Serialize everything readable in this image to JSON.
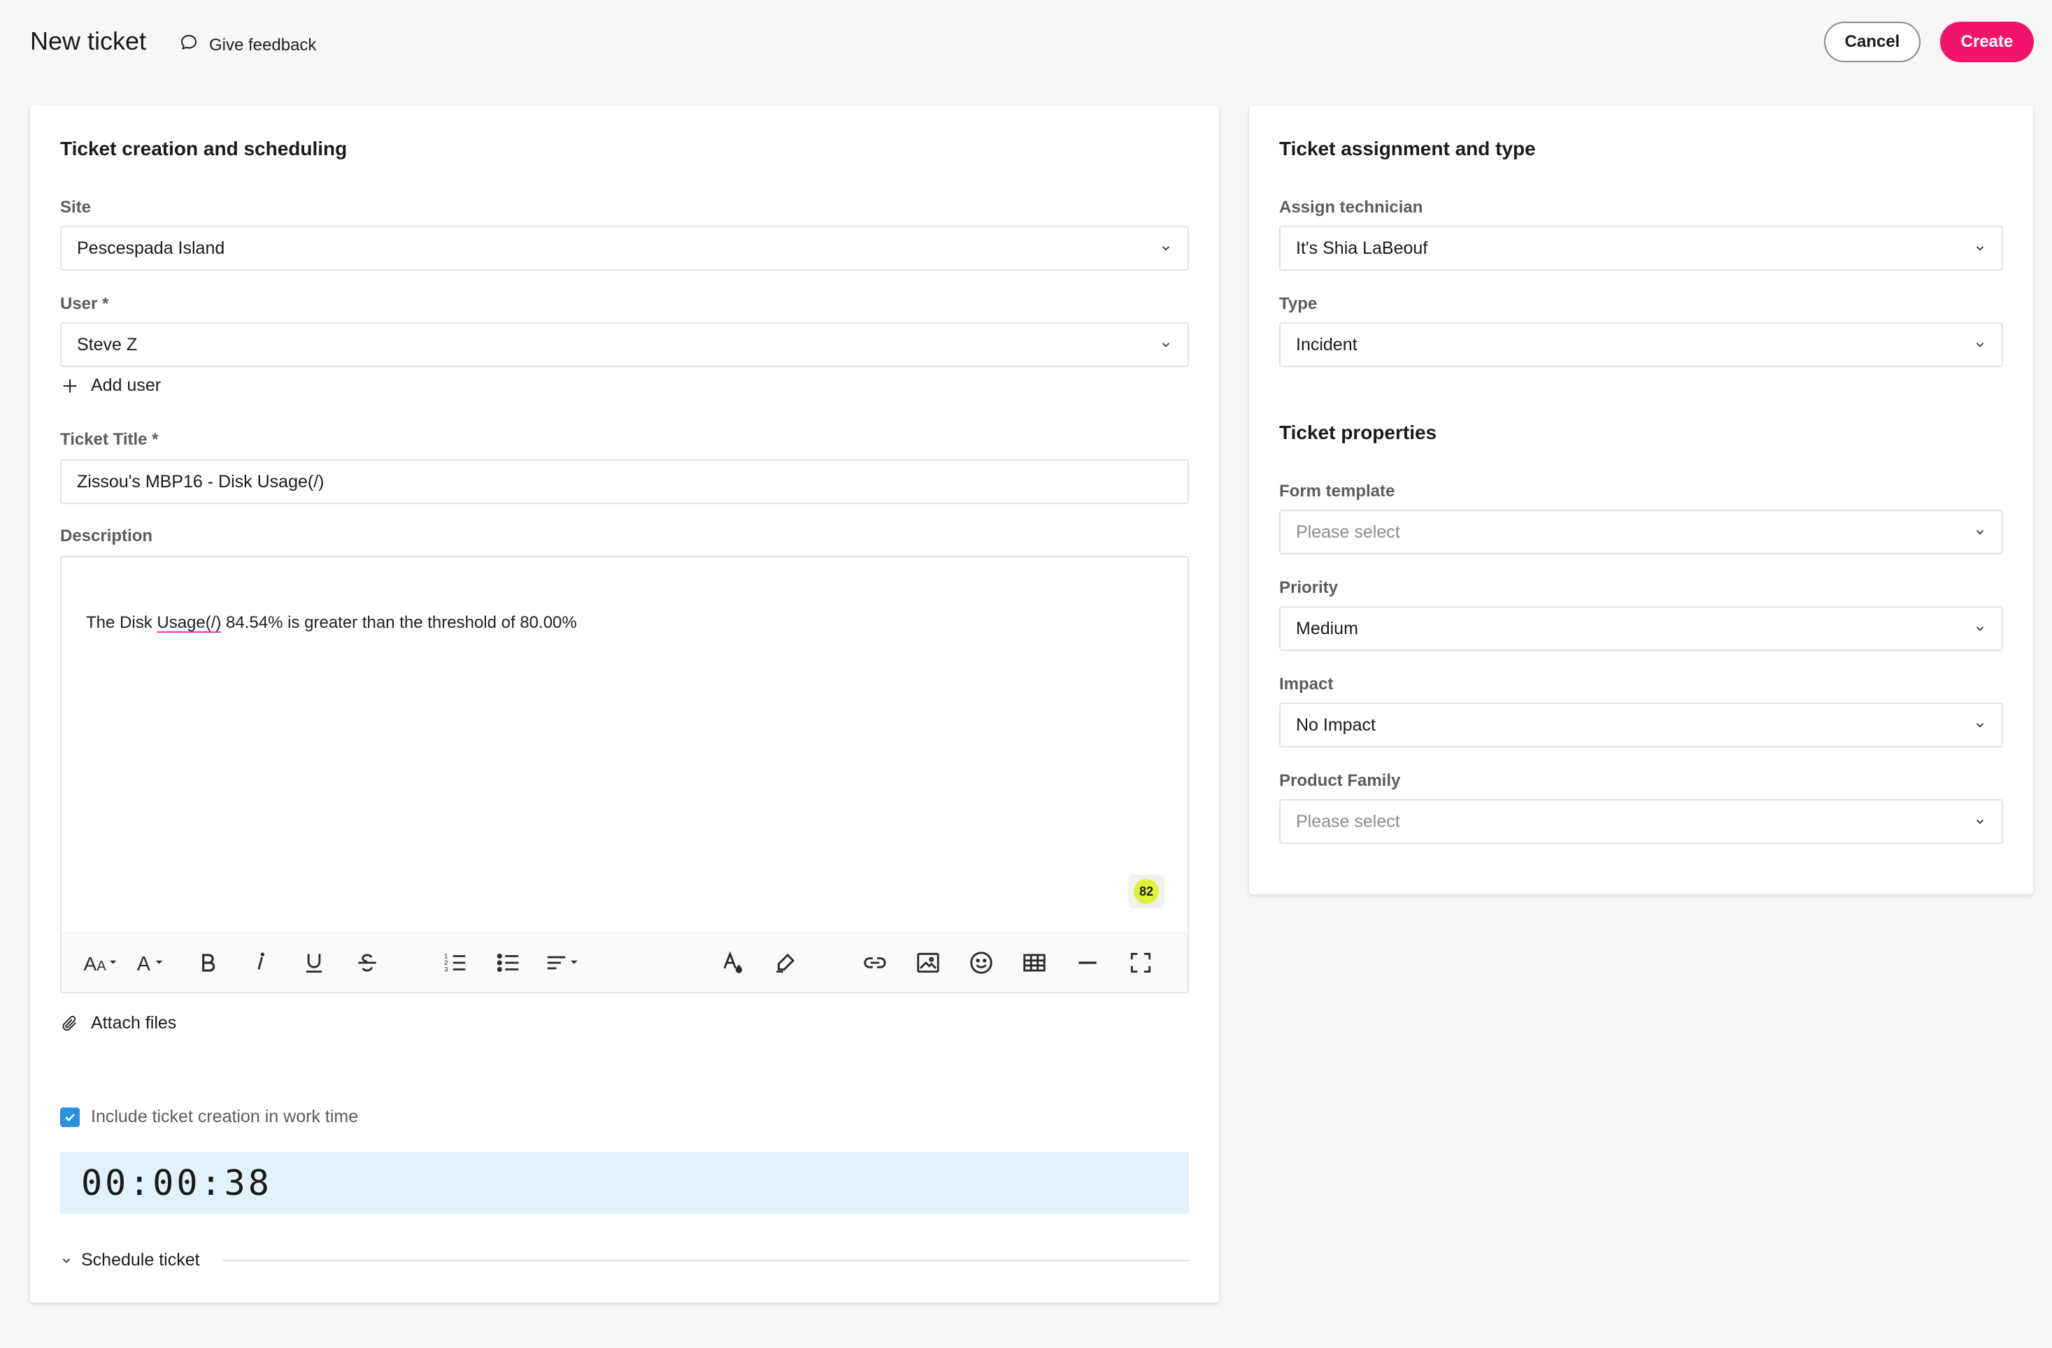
{
  "header": {
    "title": "New ticket",
    "feedback_label": "Give feedback",
    "cancel_label": "Cancel",
    "create_label": "Create"
  },
  "colors": {
    "accent": "#f2146b",
    "checkbox": "#2d8fe0",
    "timer_bg": "#e2f1fb",
    "badge": "#dff23a"
  },
  "left": {
    "section_title": "Ticket creation and scheduling",
    "site": {
      "label": "Site",
      "value": "Pescespada Island"
    },
    "user": {
      "label": "User *",
      "value": "Steve Z"
    },
    "add_user_label": "Add user",
    "ticket_title": {
      "label": "Ticket Title *",
      "value": "Zissou's MBP16 - Disk Usage(/)"
    },
    "description": {
      "label": "Description",
      "text_before": "The Disk ",
      "text_underlined": "Usage(/)",
      "text_after": " 84.54% is greater than the threshold of 80.00%",
      "count": "82"
    },
    "toolbar": [
      "font-size-icon",
      "font-family-icon",
      "bold-icon",
      "italic-icon",
      "underline-icon",
      "strikethrough-icon",
      "ordered-list-icon",
      "unordered-list-icon",
      "align-icon",
      "text-color-icon",
      "highlight-icon",
      "link-icon",
      "image-icon",
      "emoji-icon",
      "table-icon",
      "horizontal-rule-icon",
      "fullscreen-icon"
    ],
    "attach_label": "Attach files",
    "include_worktime_label": "Include ticket creation in work time",
    "include_worktime_checked": true,
    "timer": "00:00:38",
    "schedule_label": "Schedule ticket"
  },
  "right": {
    "assignment_title": "Ticket assignment and type",
    "technician": {
      "label": "Assign technician",
      "value": "It's Shia LaBeouf"
    },
    "type": {
      "label": "Type",
      "value": "Incident"
    },
    "properties_title": "Ticket properties",
    "form_template": {
      "label": "Form template",
      "placeholder": "Please select"
    },
    "priority": {
      "label": "Priority",
      "value": "Medium"
    },
    "impact": {
      "label": "Impact",
      "value": "No Impact"
    },
    "product_family": {
      "label": "Product Family",
      "placeholder": "Please select"
    }
  }
}
